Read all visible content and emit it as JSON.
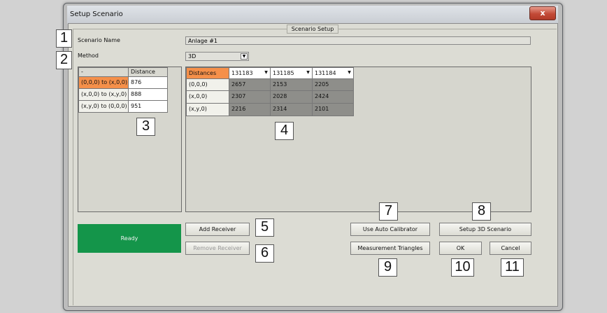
{
  "window": {
    "title": "Setup Scenario",
    "close_glyph": "x"
  },
  "group": {
    "title": "Scenario Setup"
  },
  "scenario": {
    "name_label": "Scenario Name",
    "name_value": "Anlage #1",
    "method_label": "Method",
    "method_value": "3D"
  },
  "distance_table": {
    "headers": [
      "-",
      "Distance"
    ],
    "rows": [
      {
        "label": "(0,0,0) to (x,0,0)",
        "value": "876"
      },
      {
        "label": "(x,0,0) to (x,y,0)",
        "value": "888"
      },
      {
        "label": "(x,y,0) to (0,0,0)",
        "value": "951"
      }
    ]
  },
  "distances_table": {
    "corner": "Distances",
    "receivers": [
      "131183",
      "131185",
      "131184"
    ],
    "rows": [
      {
        "label": "(0,0,0)",
        "values": [
          "2657",
          "2153",
          "2205"
        ]
      },
      {
        "label": "(x,0,0)",
        "values": [
          "2307",
          "2028",
          "2424"
        ]
      },
      {
        "label": "(x,y,0)",
        "values": [
          "2216",
          "2314",
          "2101"
        ]
      }
    ]
  },
  "buttons": {
    "add_receiver": "Add Receiver",
    "remove_receiver": "Remove Receiver",
    "use_auto_calibrator": "Use Auto Calibrator",
    "setup_3d": "Setup 3D Scenario",
    "measurement_triangles": "Measurement Triangles",
    "ok": "OK",
    "cancel": "Cancel"
  },
  "status": {
    "text": "Ready",
    "color": "#14954a"
  },
  "callouts": [
    "1",
    "2",
    "3",
    "4",
    "5",
    "6",
    "7",
    "8",
    "9",
    "10",
    "11"
  ],
  "colors": {
    "orange_header": "#f5904a",
    "grey_cells": "#8e8e8a"
  }
}
